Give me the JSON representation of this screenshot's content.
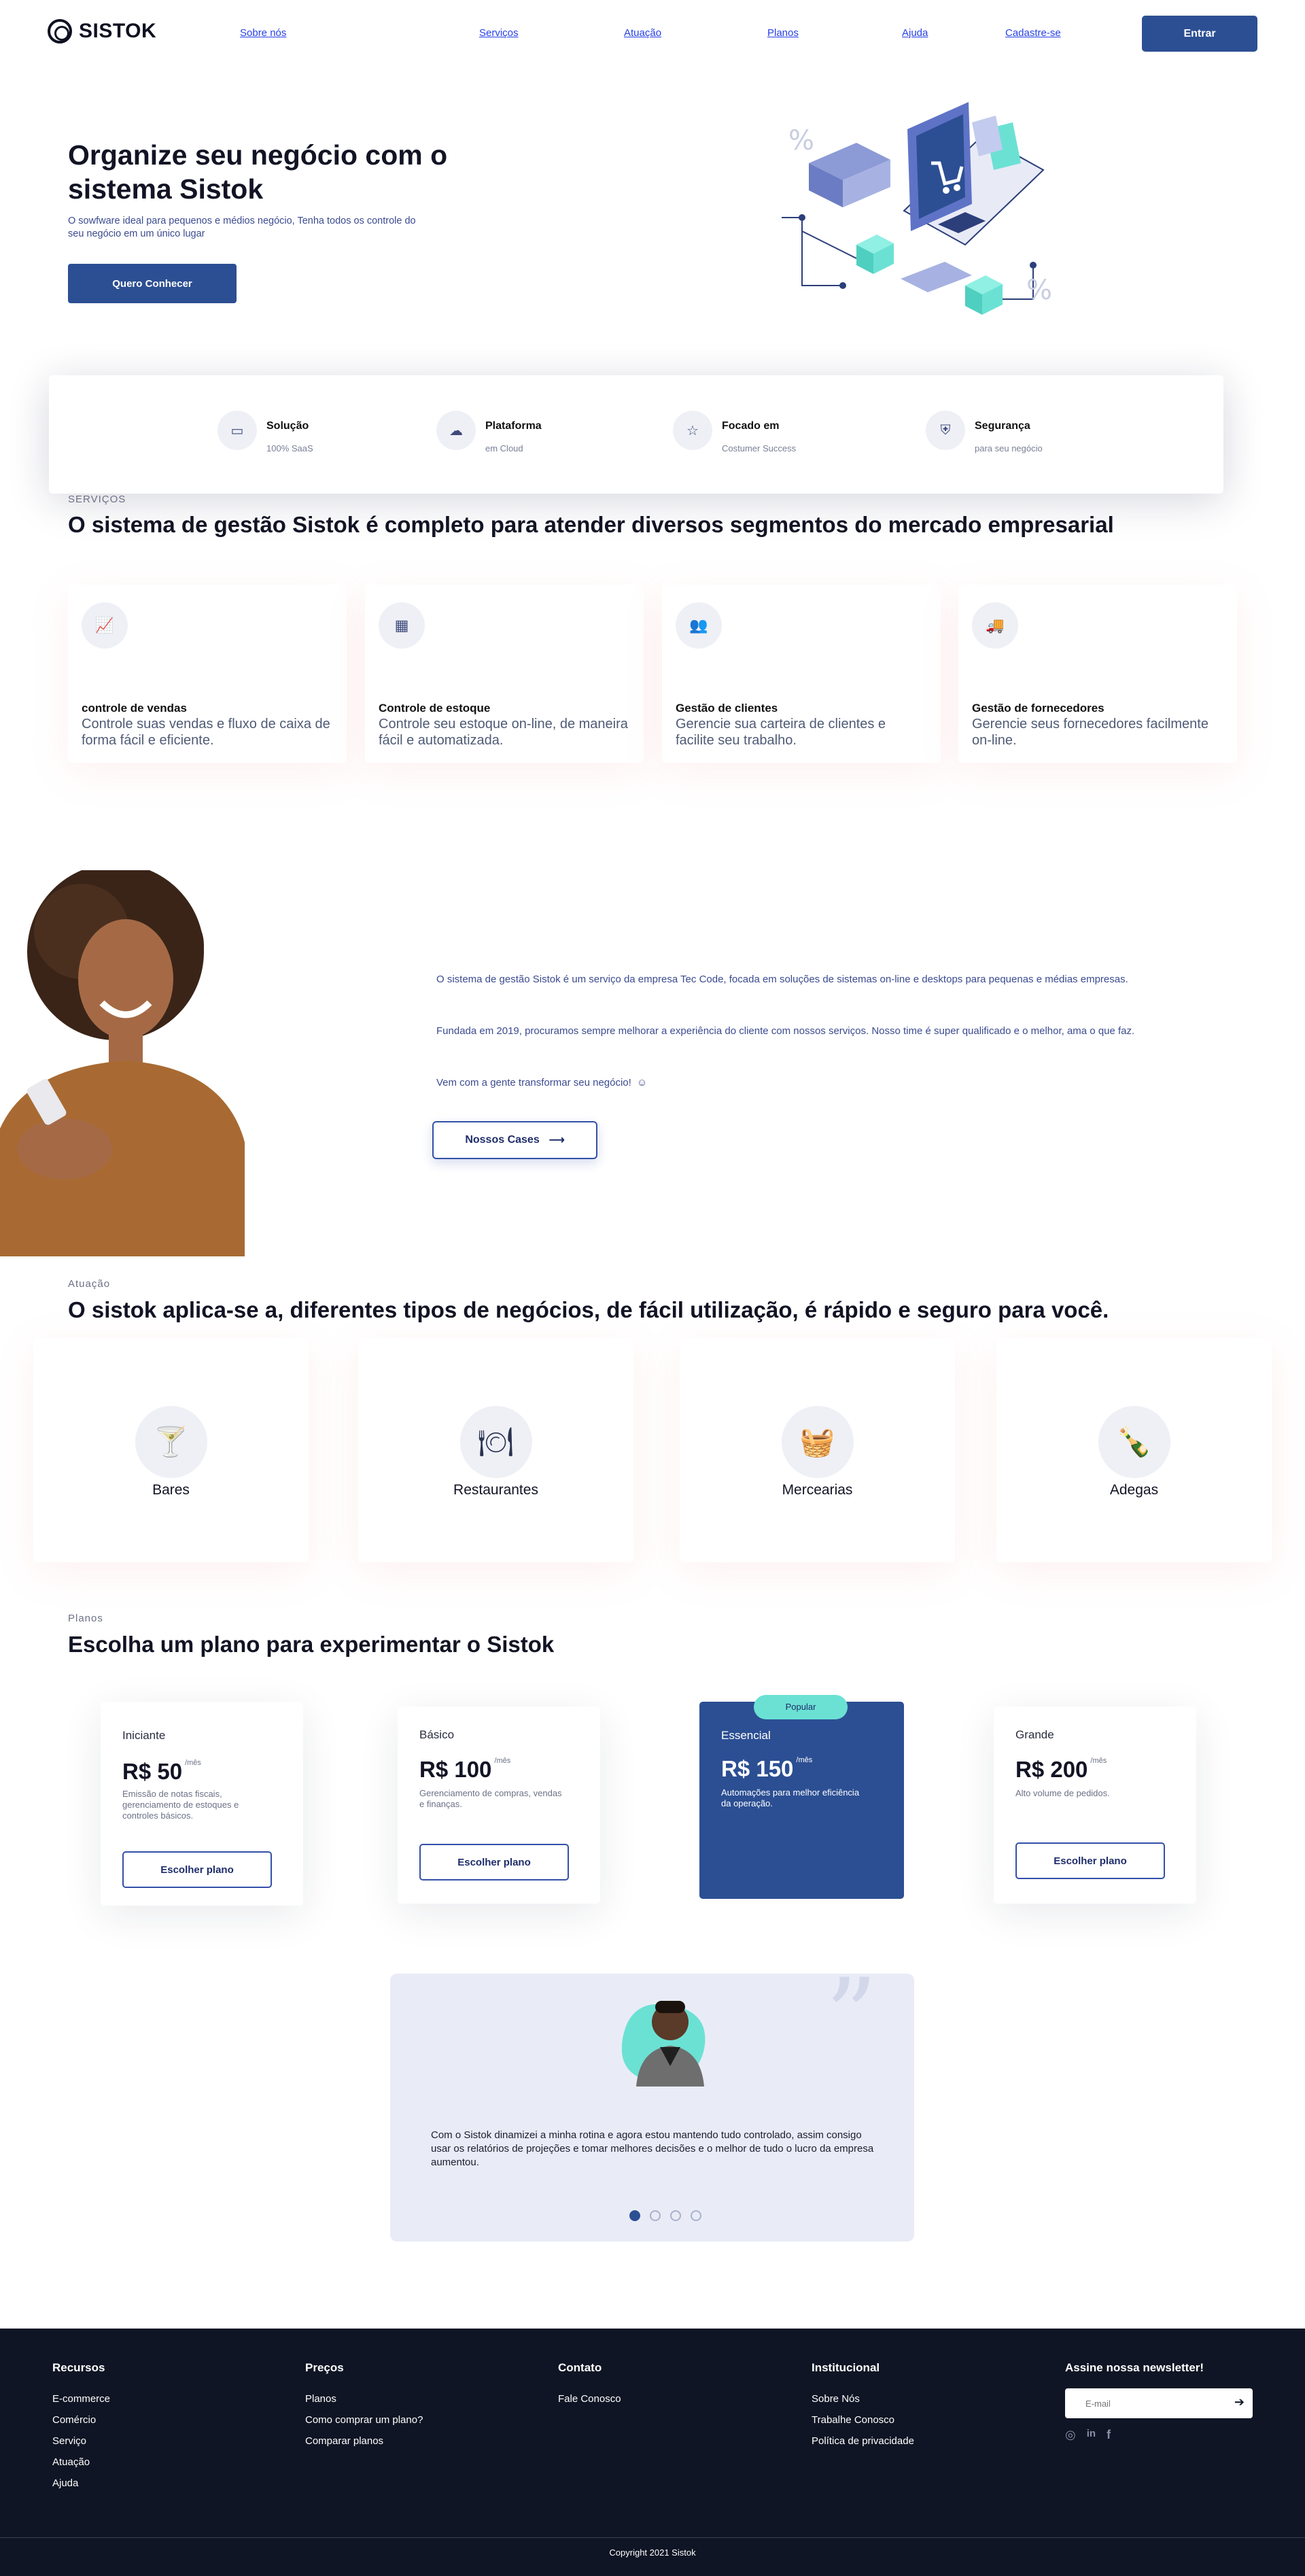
{
  "brand": {
    "name": "SISTOK"
  },
  "nav": {
    "links": [
      "Sobre nós",
      "Serviços",
      "Atuação",
      "Planos",
      "Ajuda",
      "Cadastre-se"
    ],
    "cta": "Entrar"
  },
  "hero": {
    "title": "Organize seu negócio com o sistema Sistok",
    "subtitle": "O sowfware ideal para pequenos e médios negócio, Tenha todos os controle do seu negócio em um único lugar",
    "cta": "Quero Conhecer"
  },
  "features": [
    {
      "title": "Solução",
      "sub": "100% SaaS",
      "icon": "monitor-icon"
    },
    {
      "title": "Plataforma",
      "sub": "em Cloud",
      "icon": "cloud-icon"
    },
    {
      "title": "Focado em",
      "sub": "Costumer Success",
      "icon": "star-icon"
    },
    {
      "title": "Segurança",
      "sub": "para seu negócio",
      "icon": "shield-icon"
    }
  ],
  "services": {
    "eyebrow": "SERVIÇOS",
    "title": "O sistema de gestão Sistok é completo para atender diversos segmentos do mercado empresarial",
    "cards": [
      {
        "title": "controle de vendas",
        "desc": "Controle suas vendas e fluxo de caixa de forma fácil e eficiente.",
        "icon": "chart-icon"
      },
      {
        "title": "Controle de estoque",
        "desc": "Controle seu estoque on-line, de maneira fácil e automatizada.",
        "icon": "boxes-icon"
      },
      {
        "title": "Gestão de clientes",
        "desc": "Gerencie sua carteira de clientes e facilite seu trabalho.",
        "icon": "users-icon"
      },
      {
        "title": "Gestão de fornecedores",
        "desc": "Gerencie seus fornecedores facilmente on-line.",
        "icon": "truck-icon"
      }
    ]
  },
  "about": {
    "p1": "O sistema de gestão Sistok é um serviço da empresa Tec Code, focada em soluções de sistemas on-line e desktops para pequenas e médias empresas.",
    "p2": "Fundada em 2019, procuramos sempre melhorar a experiência do cliente com nossos serviços. Nosso time é super qualificado e o melhor, ama o que faz.",
    "p3": "Vem com a gente transformar seu negócio!",
    "cta": "Nossos Cases"
  },
  "atuacao": {
    "eyebrow": "Atuação",
    "title": "O sistok aplica-se a, diferentes tipos de negócios, de fácil utilização, é rápido e seguro para você.",
    "items": [
      {
        "label": "Bares",
        "icon": "cocktail-icon"
      },
      {
        "label": "Restaurantes",
        "icon": "plate-icon"
      },
      {
        "label": "Mercearias",
        "icon": "basket-icon"
      },
      {
        "label": "Adegas",
        "icon": "bottle-icon"
      }
    ]
  },
  "planos": {
    "eyebrow": "Planos",
    "title": "Escolha um plano para experimentar o Sistok",
    "unit": "/mês",
    "button": "Escolher plano",
    "badge": "Popular",
    "plans": [
      {
        "name": "Iniciante",
        "price": "R$ 50",
        "desc": "Emissão de notas fiscais, gerenciamento de estoques e controles básicos."
      },
      {
        "name": "Básico",
        "price": "R$ 100",
        "desc": "Gerenciamento de compras, vendas e finanças."
      },
      {
        "name": "Essencial",
        "price": "R$ 150",
        "desc": "Automações para melhor eficiência da operação."
      },
      {
        "name": "Grande",
        "price": "R$ 200",
        "desc": "Alto volume de pedidos."
      }
    ]
  },
  "testimonial": {
    "text": "Com o Sistok dinamizei a minha rotina e agora estou mantendo tudo controlado, assim consigo usar os relatórios de projeções e tomar melhores decisões e o melhor de tudo o lucro da empresa aumentou.",
    "slides": 4,
    "active": 1
  },
  "footer": {
    "recursos": {
      "title": "Recursos",
      "links": [
        "E-commerce",
        "Comércio",
        "Serviço",
        "Atuação",
        "Ajuda"
      ]
    },
    "precos": {
      "title": "Preços",
      "links": [
        "Planos",
        "Como comprar um plano?",
        "Comparar planos"
      ]
    },
    "contato": {
      "title": "Contato",
      "links": [
        "Fale Conosco"
      ]
    },
    "institucional": {
      "title": "Institucional",
      "links": [
        "Sobre Nós",
        "Trabalhe Conosco",
        "Política de privacidade"
      ]
    },
    "newsletter": {
      "title": "Assine nossa newsletter!",
      "placeholder": "E-mail"
    },
    "copyright": "Copyright 2021 Sistok"
  },
  "colors": {
    "primary": "#2c4f93",
    "dark": "#0f1524",
    "accent": "#6be1d4"
  }
}
